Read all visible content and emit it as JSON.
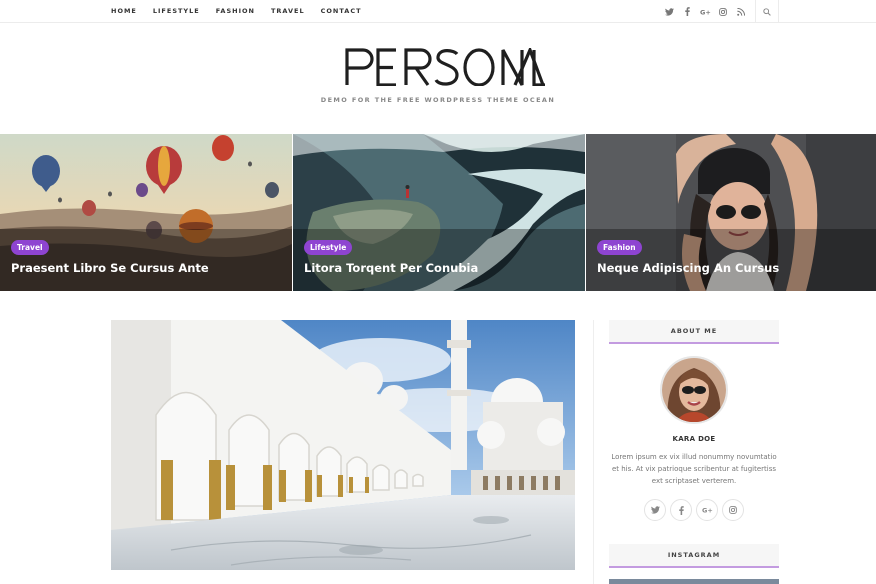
{
  "nav": {
    "menu": [
      "HOME",
      "LIFESTYLE",
      "FASHION",
      "TRAVEL",
      "CONTACT"
    ],
    "social_icons": [
      "twitter-icon",
      "facebook-icon",
      "google-plus-icon",
      "instagram-icon",
      "rss-icon"
    ],
    "social_glyphs": [
      "𝕥",
      "f",
      "G+",
      "◎",
      "≋"
    ],
    "search_icon": "search-icon"
  },
  "header": {
    "logo_text": "PERSONAL",
    "tagline": "DEMO FOR THE FREE WORDPRESS THEME OCEAN"
  },
  "featured": [
    {
      "category": "Travel",
      "title": "Praesent Libro Se Cursus Ante"
    },
    {
      "category": "Lifestyle",
      "title": "Litora Torqent Per Conubia"
    },
    {
      "category": "Fashion",
      "title": "Neque Adipiscing An Cursus"
    }
  ],
  "sidebar": {
    "about": {
      "heading": "ABOUT ME",
      "name": "KARA DOE",
      "bio": "Lorem ipsum ex vix illud nonummy novumtatio et his. At vix patrioque scribentur at fugitertiss ext scriptaset verterem.",
      "social_glyphs": [
        "𝕥",
        "f",
        "G+",
        "◎"
      ],
      "social_icons": [
        "twitter-icon",
        "facebook-icon",
        "google-plus-icon",
        "instagram-icon"
      ]
    },
    "instagram": {
      "heading": "INSTAGRAM"
    }
  },
  "colors": {
    "accent": "#8e44d1",
    "widget_border": "#c39be0"
  }
}
